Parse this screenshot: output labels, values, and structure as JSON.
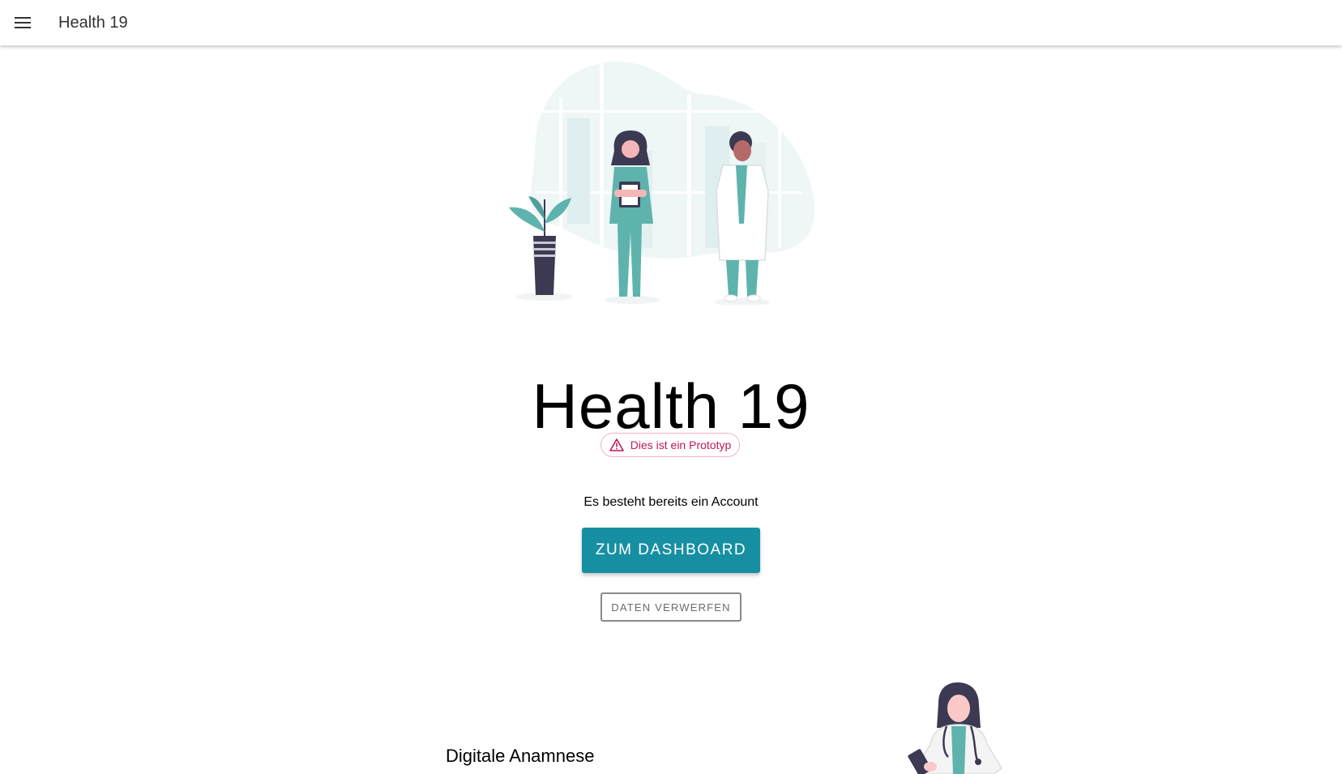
{
  "app_bar": {
    "menu_icon": "menu-icon",
    "title": "Health 19"
  },
  "hero": {
    "illustration": "doctors-illustration",
    "title": "Health 19"
  },
  "badge": {
    "icon": "warning-icon",
    "text": "Dies ist ein Prototyp"
  },
  "account": {
    "text": "Es besteht bereits ein Account",
    "dashboard_label": "ZUM DASHBOARD",
    "discard_label": "DATEN VERWERFEN"
  },
  "section": {
    "title": "Digitale Anamnese",
    "illustration": "doctor-with-stethoscope-illustration"
  },
  "colors": {
    "primary": "#178fa3",
    "warning": "#c2185b",
    "illustration_teal": "#5fb3ad",
    "illustration_bg": "#eef6f6",
    "illustration_dark": "#3b3a52"
  }
}
